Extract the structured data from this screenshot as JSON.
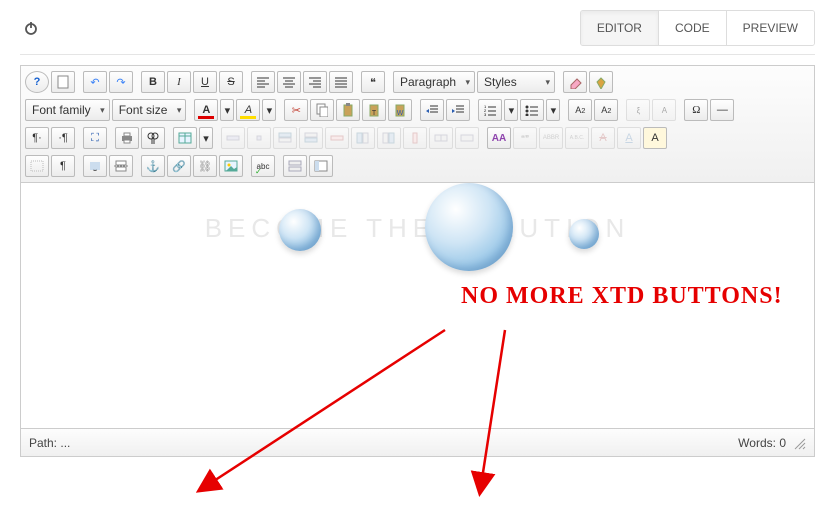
{
  "tabs": {
    "editor": "EDITOR",
    "code": "CODE",
    "preview": "PREVIEW"
  },
  "toolbar": {
    "help": "?",
    "newdoc": "□",
    "undo": "↶",
    "redo": "↷",
    "bold": "B",
    "italic": "I",
    "underline": "U",
    "strike": "S",
    "align_left": "≡",
    "align_center": "≡",
    "align_right": "≡",
    "align_justify": "≡",
    "blockquote": "❝",
    "format_select": "Paragraph",
    "styles_select": "Styles",
    "eraser": "⌫",
    "cleanup": "✓",
    "fontfamily_select": "Font family",
    "fontsize_select": "Font size",
    "forecolor": "A",
    "backcolor": "A",
    "cut": "✂",
    "copy": "⎘",
    "paste": "📋",
    "paste_text": "📋",
    "paste_word": "📋",
    "indent": "→",
    "outdent": "←",
    "ol": "1.",
    "ul": "•",
    "sup": "A²",
    "sub": "A₂",
    "print": "⎙",
    "search": "🔍",
    "table": "⊞",
    "layer": "▭",
    "layer_fwd": "▭",
    "layer_back": "▭",
    "layer_abs": "▭",
    "insert_col_l": "|",
    "insert_col_r": "|",
    "insert_row_t": "—",
    "insert_row_b": "—",
    "del_col": "|",
    "del_row": "—",
    "split": "⊟",
    "merge": "⊞",
    "fontAA": "AA",
    "quote66": "❝❞",
    "abbr": "ABBR",
    "abc": "A.B.C.",
    "A1": "A",
    "A2": "A",
    "A3": "A",
    "omega": "Ω",
    "hr": "—",
    "pilcrow": "¶",
    "ltr": "¶",
    "rtl": "¶",
    "fullscreen": "⛶",
    "find2": "🔎",
    "insert_date": "📅",
    "anchor": "⚓",
    "link": "🔗",
    "image": "🖼",
    "media": "▶",
    "spell": "abc",
    "vis_aid": "☐",
    "template": "▤"
  },
  "canvas": {
    "watermark": "BECOME THE SOLUTION",
    "annotation": "NO MORE XTD BUTTONS!"
  },
  "statusbar": {
    "path_label": "Path:",
    "path_value": "...",
    "words_label": "Words:",
    "words_value": "0"
  }
}
